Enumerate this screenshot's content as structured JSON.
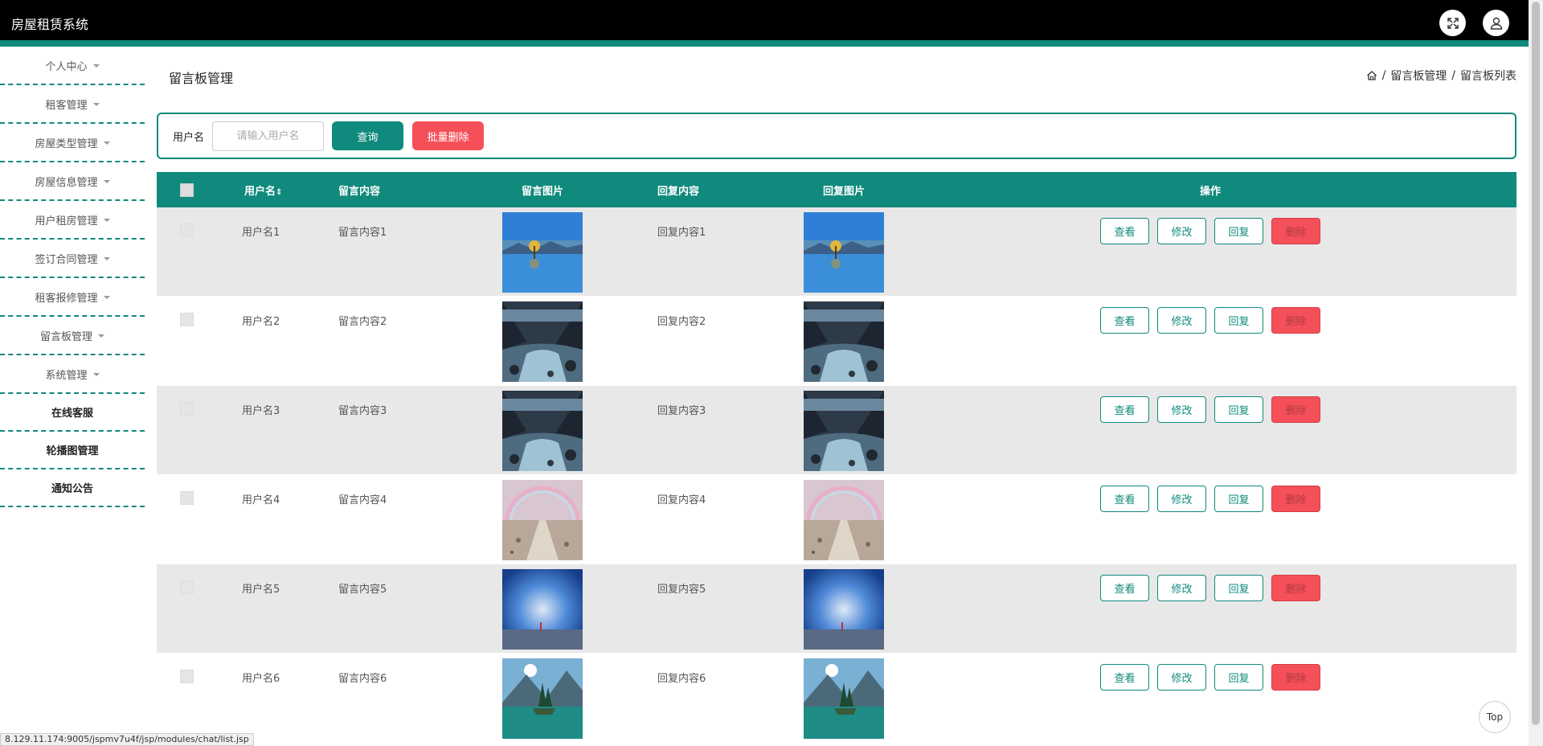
{
  "app": {
    "title": "房屋租赁系统"
  },
  "sidebar": {
    "items": [
      {
        "label": "个人中心",
        "caret": true
      },
      {
        "label": "租客管理",
        "caret": true
      },
      {
        "label": "房屋类型管理",
        "caret": true
      },
      {
        "label": "房屋信息管理",
        "caret": true
      },
      {
        "label": "用户租房管理",
        "caret": true
      },
      {
        "label": "签订合同管理",
        "caret": true
      },
      {
        "label": "租客报修管理",
        "caret": true
      },
      {
        "label": "留言板管理",
        "caret": true
      },
      {
        "label": "系统管理",
        "caret": true
      },
      {
        "label": "在线客服",
        "caret": false
      },
      {
        "label": "轮播图管理",
        "caret": false
      },
      {
        "label": "通知公告",
        "caret": false
      }
    ]
  },
  "page": {
    "title": "留言板管理",
    "breadcrumb": {
      "sep": "/",
      "item1": "留言板管理",
      "item2": "留言板列表"
    }
  },
  "search": {
    "label": "用户名",
    "placeholder": "请输入用户名",
    "query_label": "查询",
    "batch_delete_label": "批量删除"
  },
  "table": {
    "headers": {
      "username": "用户名",
      "content": "留言内容",
      "image": "留言图片",
      "reply": "回复内容",
      "reply_image": "回复图片",
      "ops": "操作"
    },
    "sort_icon": "sort-icon",
    "rows": [
      {
        "username": "用户名1",
        "content": "留言内容1",
        "reply": "回复内容1",
        "image": "lake-tree"
      },
      {
        "username": "用户名2",
        "content": "留言内容2",
        "reply": "回复内容2",
        "image": "mountain-river"
      },
      {
        "username": "用户名3",
        "content": "留言内容3",
        "reply": "回复内容3",
        "image": "mountain-river"
      },
      {
        "username": "用户名4",
        "content": "留言内容4",
        "reply": "回复内容4",
        "image": "rainbow-path"
      },
      {
        "username": "用户名5",
        "content": "留言内容5",
        "reply": "回复内容5",
        "image": "blue-horizon"
      },
      {
        "username": "用户名6",
        "content": "留言内容6",
        "reply": "回复内容6",
        "image": "alpine-lake"
      }
    ],
    "ops": {
      "view": "查看",
      "edit": "修改",
      "reply": "回复",
      "delete": "删除"
    }
  },
  "misc": {
    "top_label": "Top",
    "status_url": "8.129.11.174:9005/jspmv7u4f/jsp/modules/chat/list.jsp"
  },
  "colors": {
    "accent": "#0f8a7c",
    "danger": "#f5505a",
    "topbar": "#000000"
  }
}
